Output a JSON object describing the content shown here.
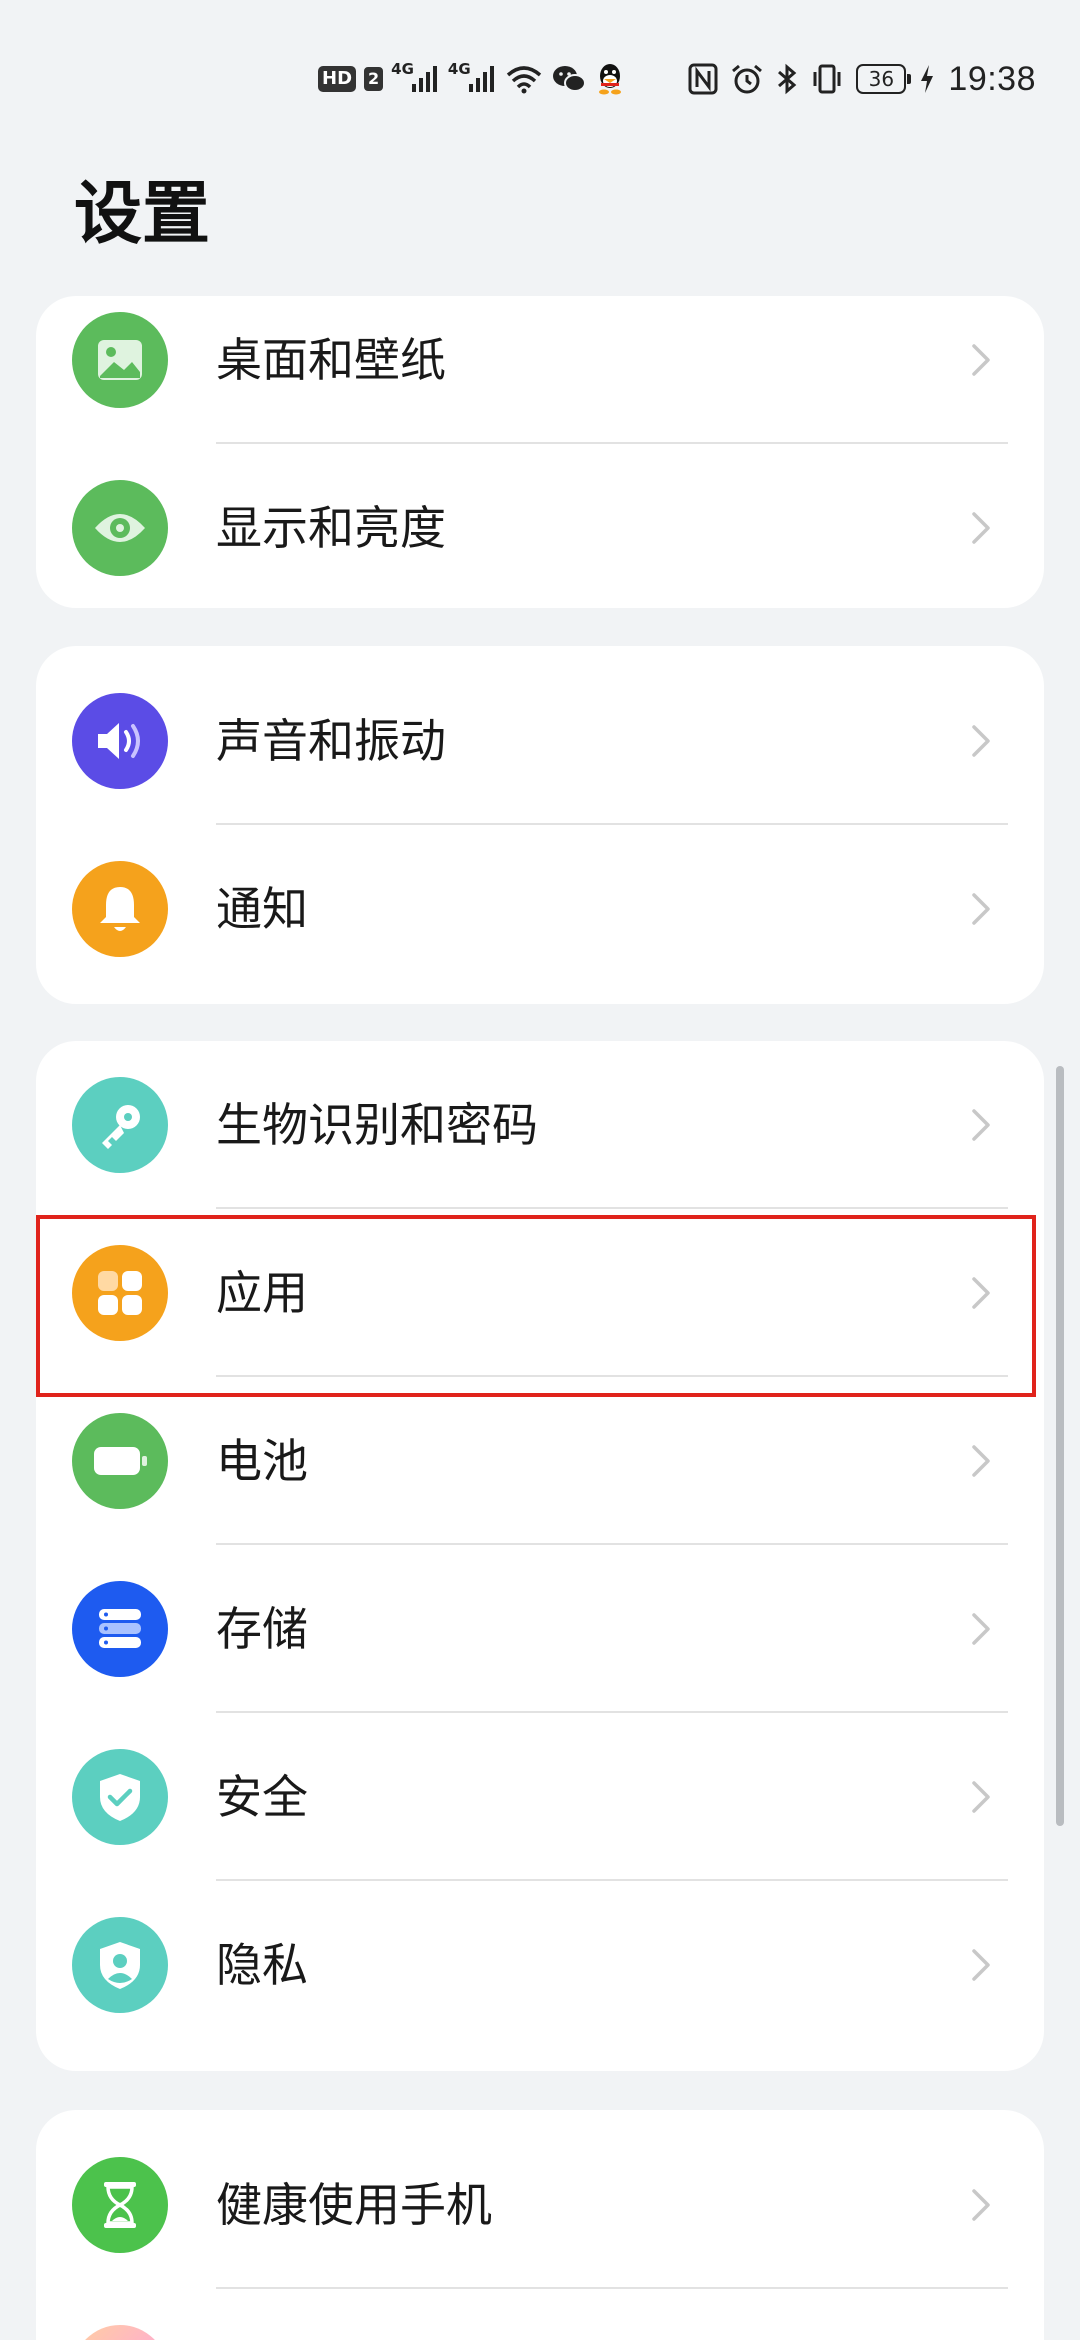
{
  "status_bar": {
    "hd": "HD",
    "sim": "2",
    "net1": "4G",
    "net2": "4G",
    "battery": "36",
    "time": "19:38"
  },
  "title": "设置",
  "cards": [
    {
      "items": [
        {
          "label": "桌面和壁纸",
          "icon": "wallpaper-icon",
          "color": "#5cbb5c"
        },
        {
          "label": "显示和亮度",
          "icon": "eye-icon",
          "color": "#5cbb5c"
        }
      ]
    },
    {
      "items": [
        {
          "label": "声音和振动",
          "icon": "speaker-icon",
          "color": "#5b4ce6"
        },
        {
          "label": "通知",
          "icon": "bell-icon",
          "color": "#f5a21c"
        }
      ]
    },
    {
      "items": [
        {
          "label": "生物识别和密码",
          "icon": "key-icon",
          "color": "#5ccfc0"
        },
        {
          "label": "应用",
          "icon": "apps-icon",
          "color": "#f5a21c"
        },
        {
          "label": "电池",
          "icon": "battery-icon",
          "color": "#5cbb5c"
        },
        {
          "label": "存储",
          "icon": "storage-icon",
          "color": "#1e5bf0"
        },
        {
          "label": "安全",
          "icon": "shield-check-icon",
          "color": "#5ccfc0"
        },
        {
          "label": "隐私",
          "icon": "privacy-shield-icon",
          "color": "#5ccfc0"
        }
      ]
    },
    {
      "items": [
        {
          "label": "健康使用手机",
          "icon": "hourglass-icon",
          "color": "#4cc24c"
        }
      ]
    }
  ],
  "highlight_color": "#e0231b"
}
